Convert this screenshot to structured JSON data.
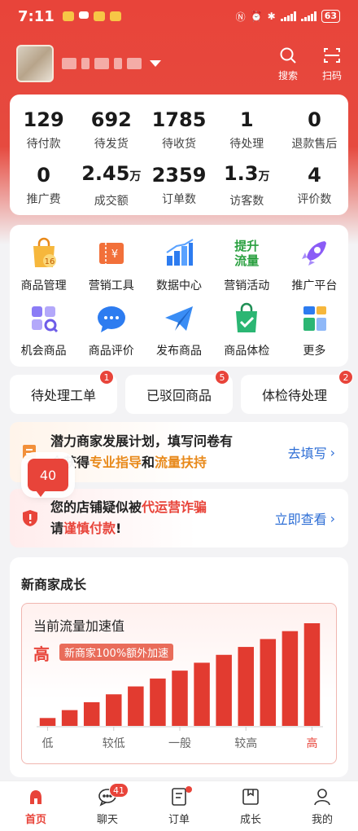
{
  "status_bar": {
    "time": "7:11",
    "battery": "63"
  },
  "header": {
    "search_label": "搜索",
    "scan_label": "扫码"
  },
  "stats": [
    [
      {
        "value": "129",
        "unit": "",
        "label": "待付款"
      },
      {
        "value": "692",
        "unit": "",
        "label": "待发货"
      },
      {
        "value": "1785",
        "unit": "",
        "label": "待收货"
      },
      {
        "value": "1",
        "unit": "",
        "label": "待处理"
      },
      {
        "value": "0",
        "unit": "",
        "label": "退款售后"
      }
    ],
    [
      {
        "value": "0",
        "unit": "",
        "label": "推广费"
      },
      {
        "value": "2.45",
        "unit": "万",
        "label": "成交额"
      },
      {
        "value": "2359",
        "unit": "",
        "label": "订单数"
      },
      {
        "value": "1.3",
        "unit": "万",
        "label": "访客数"
      },
      {
        "value": "4",
        "unit": "",
        "label": "评价数"
      }
    ]
  ],
  "tools": [
    [
      {
        "label": "商品管理",
        "icon": "shopping-bag-icon",
        "badge": "16"
      },
      {
        "label": "营销工具",
        "icon": "coupon-icon"
      },
      {
        "label": "数据中心",
        "icon": "bar-chart-icon"
      },
      {
        "label": "营销活动",
        "icon": "promo-text-icon",
        "icon_text": [
          "提升",
          "流量"
        ]
      },
      {
        "label": "推广平台",
        "icon": "rocket-icon"
      }
    ],
    [
      {
        "label": "机会商品",
        "icon": "grid-search-icon"
      },
      {
        "label": "商品评价",
        "icon": "chat-bubble-icon"
      },
      {
        "label": "发布商品",
        "icon": "paper-plane-icon"
      },
      {
        "label": "商品体检",
        "icon": "check-bag-icon"
      },
      {
        "label": "更多",
        "icon": "more-apps-icon"
      }
    ]
  ],
  "tabs": [
    {
      "label": "待处理工单",
      "badge": "1"
    },
    {
      "label": "已驳回商品",
      "badge": "5"
    },
    {
      "label": "体检待处理",
      "badge": "2"
    }
  ],
  "notices": {
    "n1": {
      "line1": "潜力商家发展计划，填写问卷有",
      "line2_pre": "会获得",
      "line2_hl1": "专业指导",
      "line2_mid": "和",
      "line2_hl2": "流量扶持",
      "link": "去填写"
    },
    "n2": {
      "line1_pre": "您的店铺疑似被",
      "line1_hl": "代运营诈骗",
      "line2_pre": "请",
      "line2_hl": "谨慎付款",
      "line2_post": "!",
      "link": "立即查看"
    }
  },
  "float_bubble": "40",
  "growth": {
    "title": "新商家成长",
    "speed_title": "当前流量加速值",
    "level": "高",
    "tag": "新商家100%额外加速"
  },
  "chart_data": {
    "type": "bar",
    "values": [
      1,
      2,
      3,
      4,
      5,
      6,
      7,
      8,
      9,
      10,
      11,
      12,
      13
    ],
    "x_tick_labels": [
      "低",
      "较低",
      "一般",
      "较高",
      "高"
    ],
    "highlight_tick": "高",
    "colors": {
      "bar": "#e23b30",
      "axis": "#cccccc",
      "tick": "#666666",
      "tick_active": "#e8443a"
    }
  },
  "tabbar": [
    {
      "label": "首页",
      "active": true
    },
    {
      "label": "聊天",
      "badge": "41"
    },
    {
      "label": "订单",
      "dot": true
    },
    {
      "label": "成长"
    },
    {
      "label": "我的"
    }
  ],
  "colors": {
    "brand": "#e8443a",
    "link": "#2f6fd6",
    "highlight": "#e8891a"
  }
}
